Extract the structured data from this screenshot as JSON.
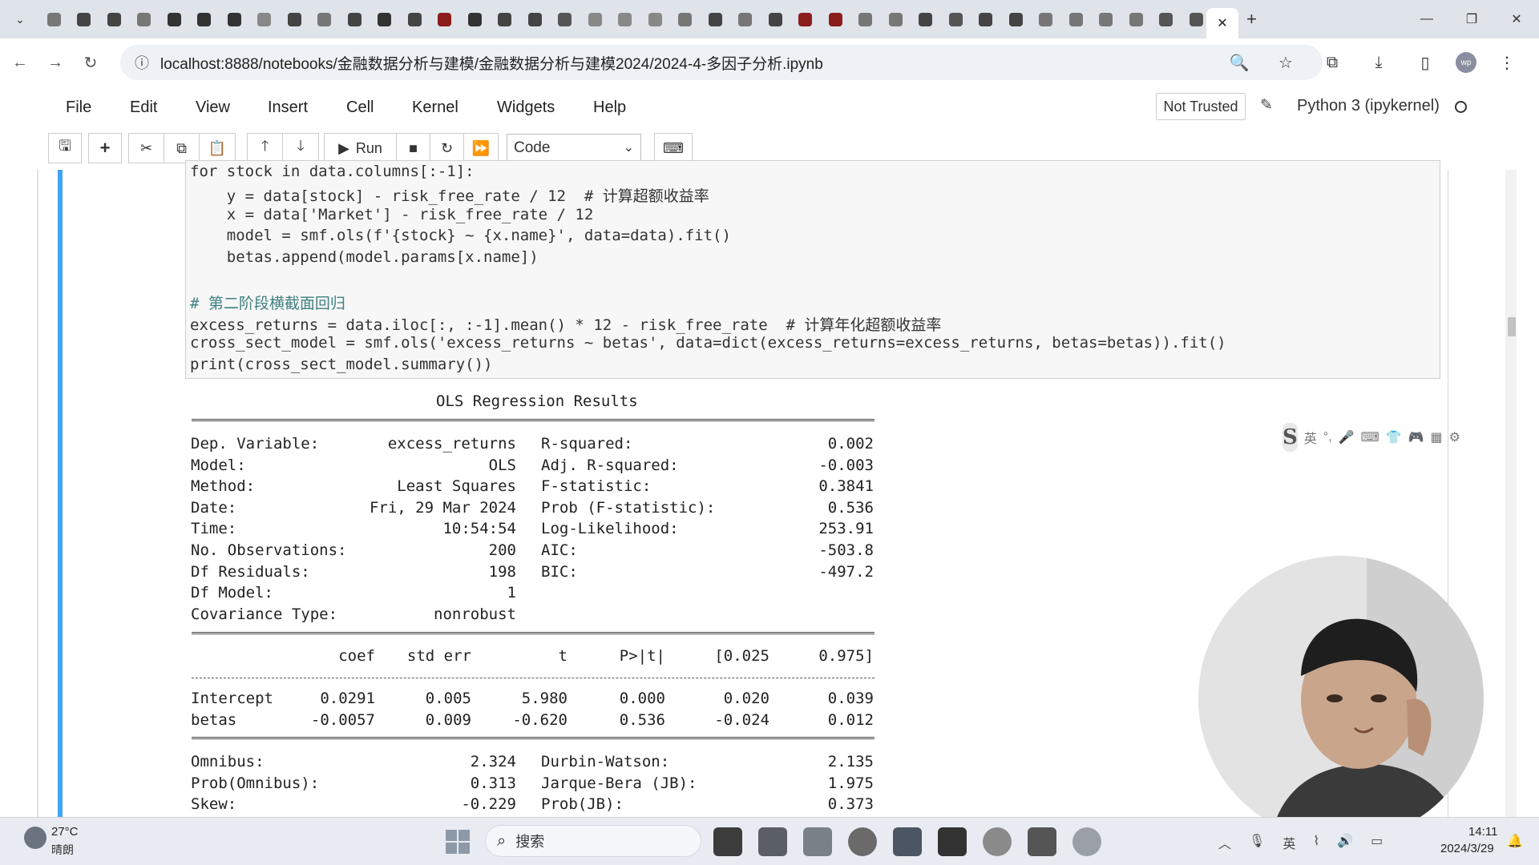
{
  "browser": {
    "active_tab_close": "✕",
    "new_tab": "+",
    "url": "localhost:8888/notebooks/金融数据分析与建模/金融数据分析与建模2024/2024-4-多因子分析.ipynb",
    "tab_favicon_colors": [
      "#777",
      "#444",
      "#444",
      "#777",
      "#333",
      "#333",
      "#333",
      "#888",
      "#444",
      "#777",
      "#444",
      "#333",
      "#444",
      "#8b1d1d",
      "#333",
      "#444",
      "#444",
      "#555",
      "#888",
      "#888",
      "#888",
      "#777",
      "#444",
      "#777",
      "#444",
      "#8b1d1d",
      "#8b1d1d",
      "#777",
      "#777",
      "#444",
      "#555",
      "#444",
      "#444",
      "#777",
      "#777",
      "#777",
      "#777",
      "#555",
      "#555"
    ]
  },
  "menu": {
    "file": "File",
    "edit": "Edit",
    "view": "View",
    "insert": "Insert",
    "cell": "Cell",
    "kernel": "Kernel",
    "widgets": "Widgets",
    "help": "Help",
    "not_trusted": "Not Trusted",
    "kernel_name": "Python 3 (ipykernel)"
  },
  "toolbar": {
    "run_label": "Run",
    "cell_type": "Code"
  },
  "code_lines": [
    "for stock in data.columns[:-1]:",
    "    y = data[stock] - risk_free_rate / 12  # 计算超额收益率",
    "    x = data['Market'] - risk_free_rate / 12",
    "    model = smf.ols(f'{stock} ~ {x.name}', data=data).fit()",
    "    betas.append(model.params[x.name])",
    "",
    "# 第二阶段横截面回归",
    "excess_returns = data.iloc[:, :-1].mean() * 12 - risk_free_rate  # 计算年化超额收益率",
    "cross_sect_model = smf.ols('excess_returns ~ betas', data=dict(excess_returns=excess_returns, betas=betas)).fit()",
    "print(cross_sect_model.summary())"
  ],
  "output": {
    "title": "OLS Regression Results",
    "left_stats": [
      {
        "label": "Dep. Variable:",
        "value": "excess_returns"
      },
      {
        "label": "Model:",
        "value": "OLS"
      },
      {
        "label": "Method:",
        "value": "Least Squares"
      },
      {
        "label": "Date:",
        "value": "Fri, 29 Mar 2024"
      },
      {
        "label": "Time:",
        "value": "10:54:54"
      },
      {
        "label": "No. Observations:",
        "value": "200"
      },
      {
        "label": "Df Residuals:",
        "value": "198"
      },
      {
        "label": "Df Model:",
        "value": "1"
      },
      {
        "label": "Covariance Type:",
        "value": "nonrobust"
      }
    ],
    "right_stats": [
      {
        "label": "R-squared:",
        "value": "0.002"
      },
      {
        "label": "Adj. R-squared:",
        "value": "-0.003"
      },
      {
        "label": "F-statistic:",
        "value": "0.3841"
      },
      {
        "label": "Prob (F-statistic):",
        "value": "0.536"
      },
      {
        "label": "Log-Likelihood:",
        "value": "253.91"
      },
      {
        "label": "AIC:",
        "value": "-503.8"
      },
      {
        "label": "BIC:",
        "value": "-497.2"
      }
    ],
    "coef_headers": [
      "coef",
      "std err",
      "t",
      "P>|t|",
      "[0.025",
      "0.975]"
    ],
    "coef_rows": [
      {
        "name": "Intercept",
        "values": [
          "0.0291",
          "0.005",
          "5.980",
          "0.000",
          "0.020",
          "0.039"
        ]
      },
      {
        "name": "betas",
        "values": [
          "-0.0057",
          "0.009",
          "-0.620",
          "0.536",
          "-0.024",
          "0.012"
        ]
      }
    ],
    "diag_left": [
      {
        "label": "Omnibus:",
        "value": "2.324"
      },
      {
        "label": "Prob(Omnibus):",
        "value": "0.313"
      },
      {
        "label": "Skew:",
        "value": "-0.229"
      }
    ],
    "diag_right": [
      {
        "label": "Durbin-Watson:",
        "value": "2.135"
      },
      {
        "label": "Jarque-Bera (JB):",
        "value": "1.975"
      },
      {
        "label": "Prob(JB):",
        "value": "0.373"
      }
    ]
  },
  "ime": {
    "lang": "英"
  },
  "taskbar": {
    "temperature": "27°C",
    "weather": "晴朗",
    "search_placeholder": "搜索",
    "time": "14:11",
    "date": "2024/3/29"
  }
}
